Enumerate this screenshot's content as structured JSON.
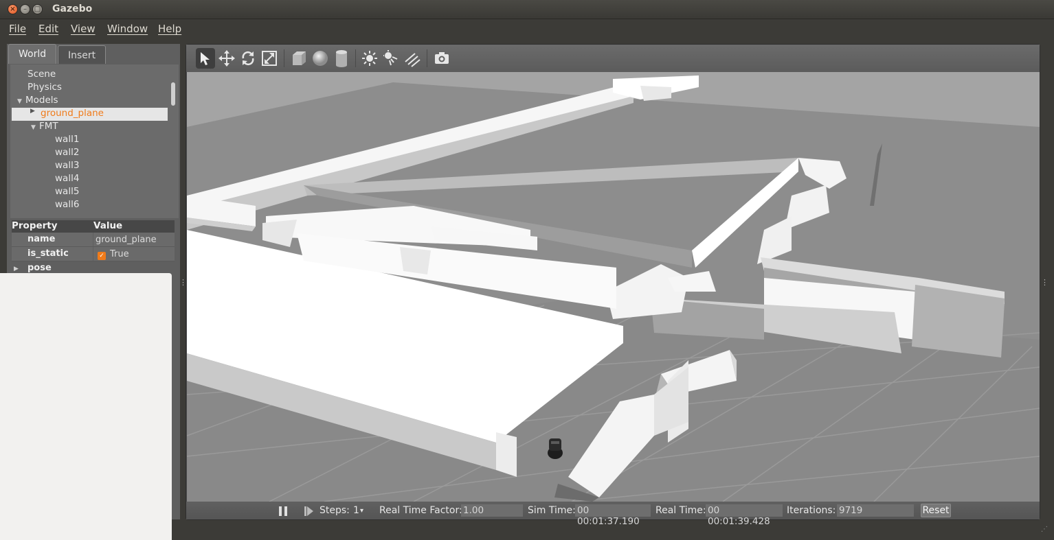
{
  "window": {
    "title": "Gazebo"
  },
  "menu": {
    "items": [
      "File",
      "Edit",
      "View",
      "Window",
      "Help"
    ]
  },
  "left_panel": {
    "tabs": {
      "world": "World",
      "insert": "Insert"
    },
    "tree": {
      "scene": "Scene",
      "physics": "Physics",
      "models": "Models",
      "ground_plane": "ground_plane",
      "fmt": "FMT",
      "walls": [
        "wall1",
        "wall2",
        "wall3",
        "wall4",
        "wall5",
        "wall6"
      ]
    },
    "properties": {
      "header_property": "Property",
      "header_value": "Value",
      "name_label": "name",
      "name_value": "ground_plane",
      "is_static_label": "is_static",
      "is_static_value": "True",
      "pose_label": "pose"
    }
  },
  "toolbar": {
    "icons": [
      "select-icon",
      "translate-icon",
      "rotate-icon",
      "scale-icon",
      "box-icon",
      "sphere-icon",
      "cylinder-icon",
      "point-light-icon",
      "spot-light-icon",
      "directional-light-icon",
      "screenshot-icon"
    ]
  },
  "statusbar": {
    "steps_label": "Steps:",
    "steps_value": "1",
    "rtf_label": "Real Time Factor:",
    "rtf_value": "1.00",
    "sim_time_label": "Sim Time:",
    "sim_time_value": "00 00:01:37.190",
    "real_time_label": "Real Time:",
    "real_time_value": "00 00:01:39.428",
    "iterations_label": "Iterations:",
    "iterations_value": "9719",
    "reset_label": "Reset"
  },
  "colors": {
    "accent": "#f07b1a",
    "background": "#3c3b37",
    "panel": "#5f5f5f",
    "floor": "#8f8f8f",
    "wall": "#ffffff"
  }
}
